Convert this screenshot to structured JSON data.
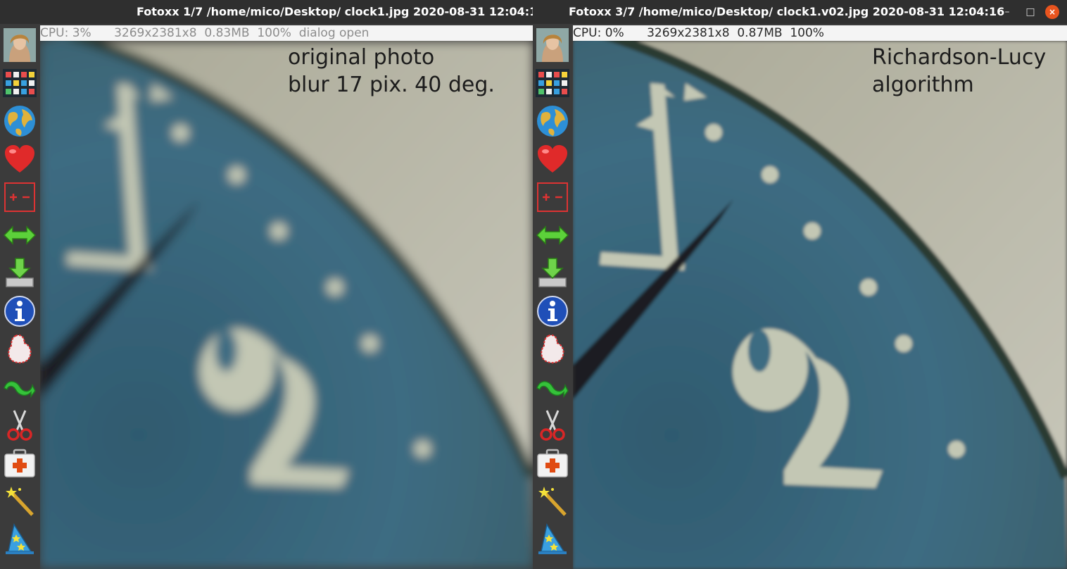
{
  "left_window": {
    "title": "Fotoxx  1/7 /home/mico/Desktop/ clock1.jpg  2020-08-31 12:04:1",
    "status": "CPU: 3%      3269x2381x8  0.83MB  100%  dialog open",
    "caption_line1": "original photo",
    "caption_line2": "blur 17 pix.  40 deg."
  },
  "right_window": {
    "title": "Fotoxx  3/7 /home/mico/Desktop/ clock1.v02.jpg  2020-08-31 12:04:16",
    "status": "CPU: 0%      3269x2381x8  0.87MB  100%",
    "caption_line1": "Richardson-Lucy",
    "caption_line2": "algorithm",
    "controls": {
      "minimize": "–",
      "maximize": "□",
      "close": "×"
    }
  },
  "toolbar_icons": [
    "portrait-thumbnail-icon",
    "gallery-grid-icon",
    "globe-icon",
    "heart-icon",
    "zoom-plus-minus-icon",
    "resize-arrows-icon",
    "save-download-icon",
    "info-icon",
    "select-area-icon",
    "rotate-undo-icon",
    "scissors-crop-icon",
    "first-aid-repair-icon",
    "magic-wand-icon",
    "wizard-hat-icon",
    "clock-icon"
  ],
  "colors": {
    "dial_blue": "#3d6c82",
    "wall_gray": "#c0bfb3",
    "dial_numeral": "#c5c9b8",
    "toolbar_bg": "#3b3b3b",
    "close_button": "#e9541e"
  }
}
